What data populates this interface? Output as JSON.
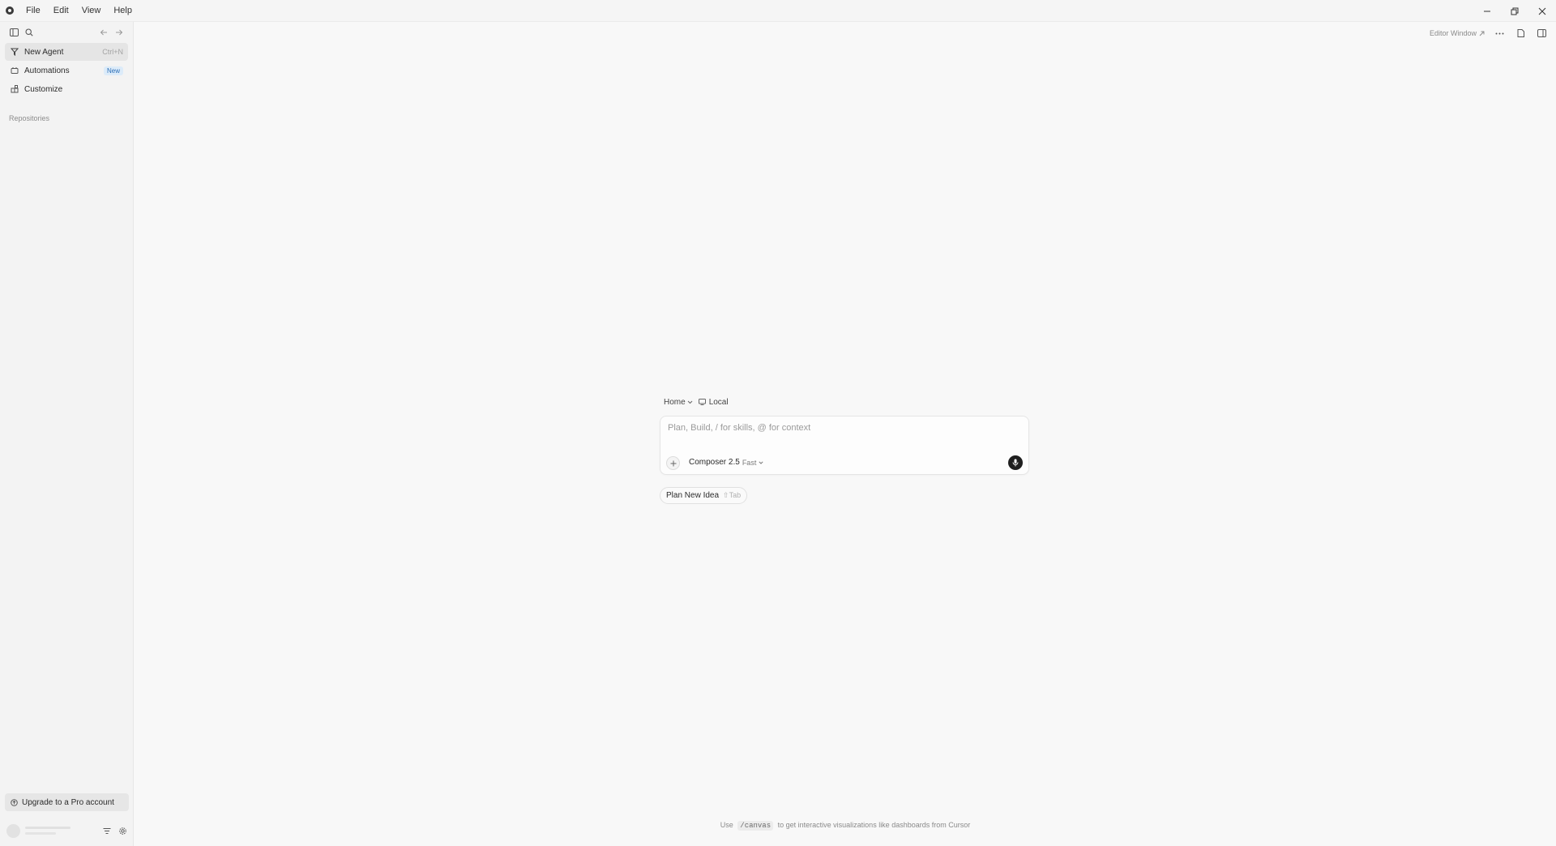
{
  "menubar": {
    "items": [
      "File",
      "Edit",
      "View",
      "Help"
    ]
  },
  "sidebar": {
    "items": [
      {
        "label": "New Agent",
        "shortcut": "Ctrl+N",
        "icon": "agent-icon"
      },
      {
        "label": "Automations",
        "badge": "New",
        "icon": "automations-icon"
      },
      {
        "label": "Customize",
        "icon": "customize-icon"
      }
    ],
    "section_label": "Repositories",
    "upgrade_label": "Upgrade to a Pro account"
  },
  "topbar": {
    "editor_window_label": "Editor Window"
  },
  "composer": {
    "context_home": "Home",
    "context_local": "Local",
    "placeholder": "Plan, Build, / for skills, @ for context",
    "model_name": "Composer 2.5",
    "model_suffix": "Fast",
    "plan_chip_label": "Plan New Idea",
    "plan_chip_hint": "⇧Tab"
  },
  "footer": {
    "prefix": "Use",
    "code": "/canvas",
    "suffix": "to get interactive visualizations like dashboards from Cursor"
  }
}
